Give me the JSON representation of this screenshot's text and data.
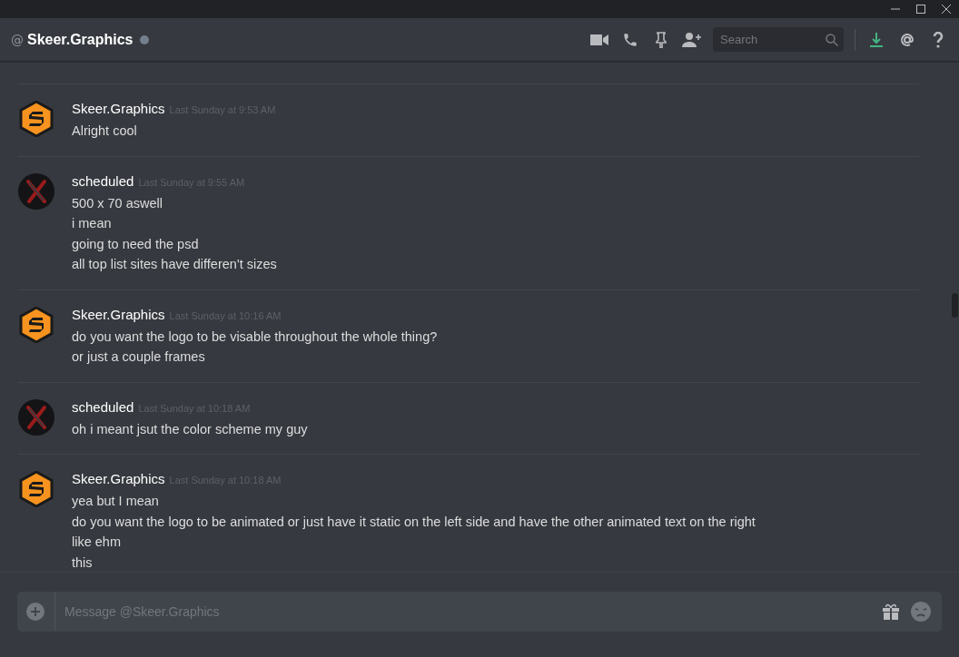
{
  "channel": {
    "at": "@",
    "name": "Skeer.Graphics"
  },
  "search": {
    "placeholder": "Search"
  },
  "messages": [
    {
      "author": "Skeer.Graphics",
      "kind": "logo",
      "time": "Last Sunday at 9:53 AM",
      "lines": [
        "Alright cool"
      ]
    },
    {
      "author": "scheduled",
      "kind": "cross",
      "time": "Last Sunday at 9:55 AM",
      "lines": [
        "500 x 70 aswell",
        "i mean",
        "going to need the psd",
        "all top list sites have differen't sizes"
      ]
    },
    {
      "author": "Skeer.Graphics",
      "kind": "logo",
      "time": "Last Sunday at 10:16 AM",
      "lines": [
        "do you want the logo to be visable throughout the whole thing?",
        "or just a couple frames"
      ]
    },
    {
      "author": "scheduled",
      "kind": "cross",
      "time": "Last Sunday at 10:18 AM",
      "lines": [
        "oh i meant jsut the color scheme my guy"
      ]
    },
    {
      "author": "Skeer.Graphics",
      "kind": "logo",
      "time": "Last Sunday at 10:18 AM",
      "lines": [
        "yea but I mean",
        "do you want the logo to be animated or just have it static on the left side and have the other animated text on the right",
        "like ehm",
        "this"
      ]
    }
  ],
  "composer": {
    "placeholder": "Message @Skeer.Graphics"
  }
}
